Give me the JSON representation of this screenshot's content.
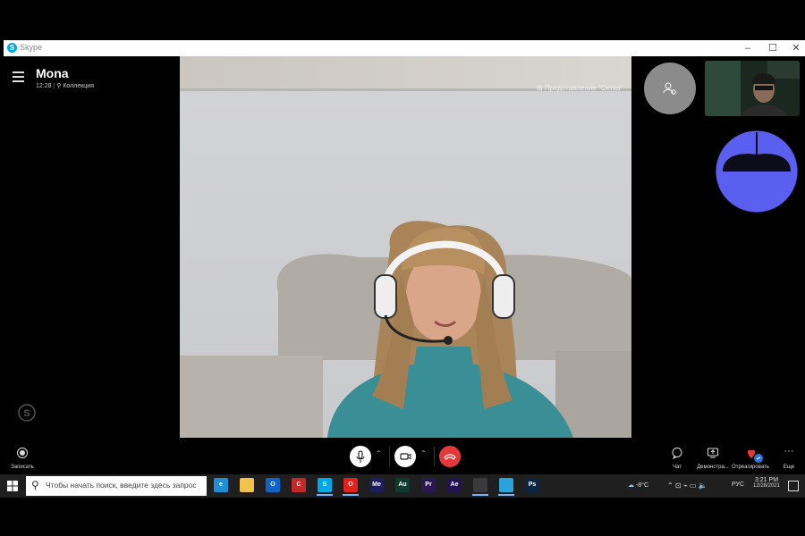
{
  "window": {
    "app_title": "Skype"
  },
  "header": {
    "contact_name": "Mona",
    "call_time": "12:28",
    "call_group": "Коллекция"
  },
  "view_toggle": "Представление \"Сетка\"",
  "controls": {
    "record_label": "Записать",
    "chat_label": "Чат",
    "share_label": "Демонстра...",
    "react_label": "Отреагировать",
    "more_label": "Еще"
  },
  "taskbar": {
    "search_placeholder": "Чтобы начать поиск, введите здесь запрос",
    "apps": [
      {
        "name": "edge",
        "text": "e",
        "color": "#1f8fd8"
      },
      {
        "name": "explorer",
        "text": "",
        "color": "#f0c24b"
      },
      {
        "name": "outlook",
        "text": "O",
        "color": "#0f64c8"
      },
      {
        "name": "c-app",
        "text": "C",
        "color": "#c62828"
      },
      {
        "name": "skype",
        "text": "S",
        "color": "#00a8e8"
      },
      {
        "name": "opera",
        "text": "O",
        "color": "#e0241b"
      },
      {
        "name": "media-encoder",
        "text": "Me",
        "color": "#1d1d5a"
      },
      {
        "name": "audition",
        "text": "Au",
        "color": "#0f3a2e"
      },
      {
        "name": "premiere",
        "text": "Pr",
        "color": "#2a1650"
      },
      {
        "name": "after-effects",
        "text": "Ae",
        "color": "#23124f"
      },
      {
        "name": "obs",
        "text": "",
        "color": "#3a3a3a"
      },
      {
        "name": "telegram",
        "text": "",
        "color": "#2aa3dd"
      },
      {
        "name": "photoshop",
        "text": "Ps",
        "color": "#0b2540"
      }
    ],
    "weather": "-8°C",
    "language": "РУС",
    "time": "3:21 PM",
    "date": "12/28/2021"
  },
  "colors": {
    "end_call": "#e5383b",
    "brand_blue": "#5b5fef",
    "accent": "#00a8e8"
  }
}
